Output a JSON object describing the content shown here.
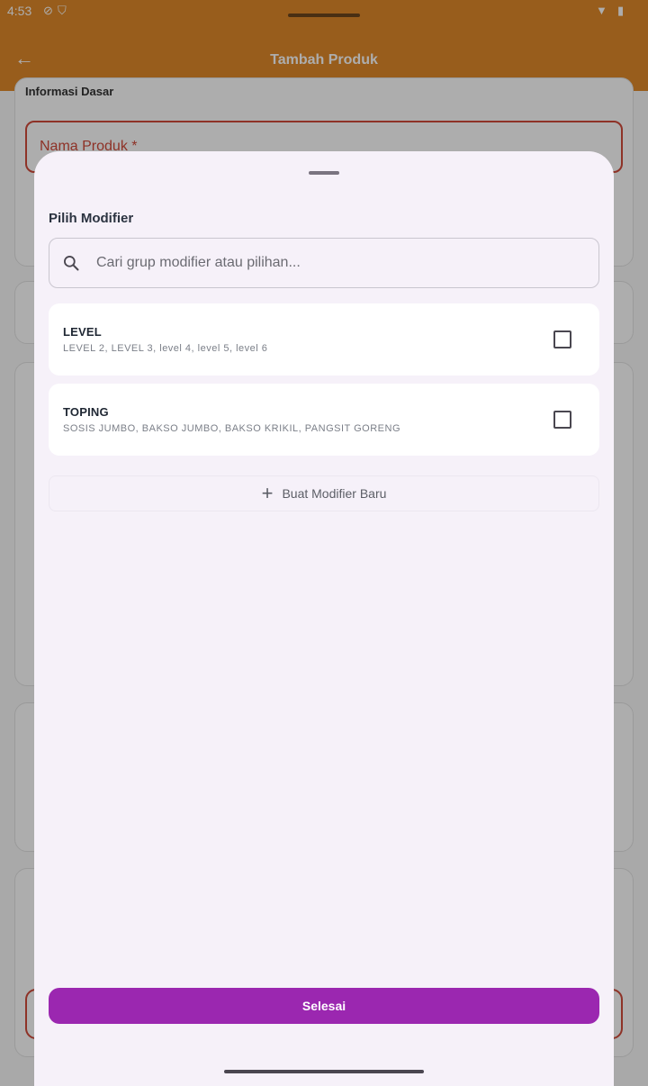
{
  "status_bar": {
    "time": "4:53"
  },
  "app_bar": {
    "title": "Tambah Produk"
  },
  "background": {
    "section_label": "Informasi Dasar",
    "name_field_label": "Nama Produk *"
  },
  "sheet": {
    "title": "Pilih Modifier",
    "search_placeholder": "Cari grup modifier atau pilihan...",
    "modifiers": [
      {
        "name": "LEVEL",
        "options": "LEVEL 2, LEVEL 3, level 4, level 5, level 6",
        "checked": false
      },
      {
        "name": "TOPING",
        "options": "SOSIS JUMBO, BAKSO JUMBO, BAKSO KRIKIL, PANGSIT GORENG",
        "checked": false
      }
    ],
    "new_modifier_label": "Buat Modifier Baru",
    "done_label": "Selesai"
  },
  "colors": {
    "app_bar": "#e08a2a",
    "primary_button": "#9b27b0",
    "sheet_background": "#f6f1f9",
    "error_outline": "#d14a3a"
  }
}
